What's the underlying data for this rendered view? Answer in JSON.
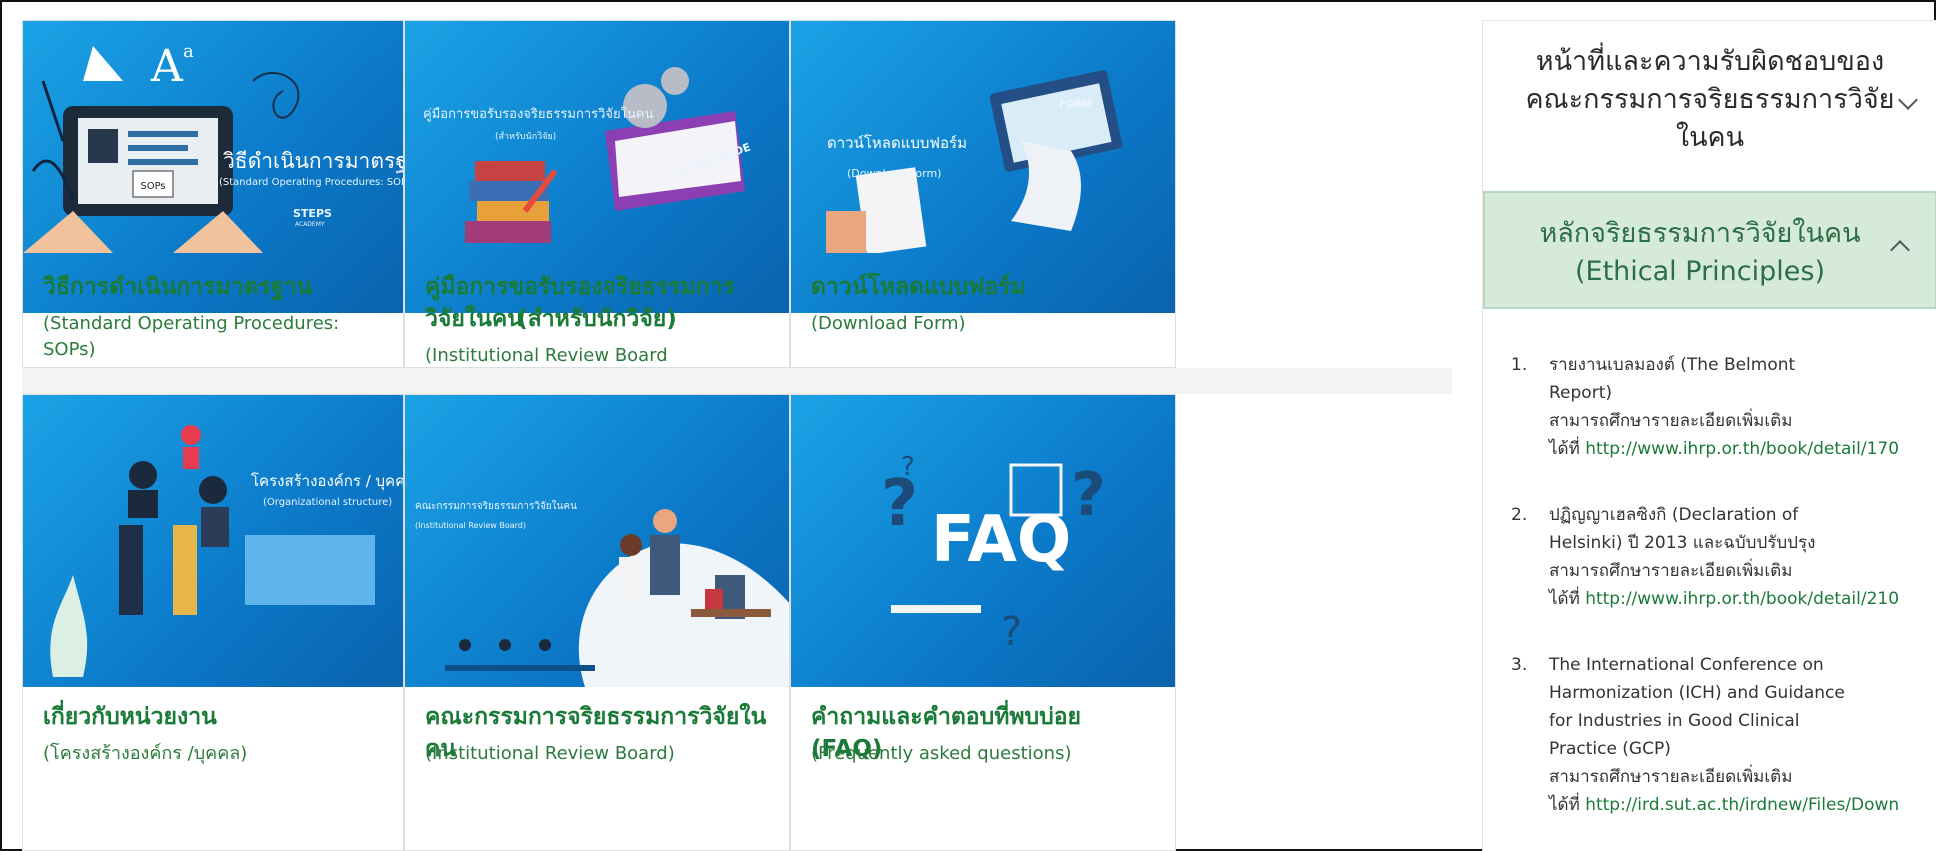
{
  "cards": [
    {
      "banner_title": "วิธีดำเนินการมาตรฐาน",
      "banner_sub": "(Standard Operating Procedures: SOPs)",
      "banner_badge": "SOPs",
      "banner_logo": "STEPS",
      "banner_logo_sub": "ACADEMY",
      "title": "วิธีการดำเนินการมาตรฐาน",
      "subtitle": "(Standard Operating Procedures: SOPs)"
    },
    {
      "banner_title": "คู่มือการขอรับรองจริยธรรมการวิจัยในคน",
      "banner_sub": "(สำหรับนักวิจัย)",
      "banner_badge": "USER GUIDE",
      "title_line1": "คู่มือการขอรับรองจริยธรรมการวิจัยในคน",
      "title_line2": "(สำหรับนักวิจัย)",
      "subtitle": "(Institutional Review Board Guildbook)"
    },
    {
      "banner_title": "ดาวน์โหลดแบบฟอร์ม",
      "banner_sub": "(Download Form)",
      "banner_badge": "FORM",
      "title": "ดาวน์โหลดแบบฟอร์ม",
      "subtitle": "(Download Form)"
    },
    {
      "banner_title": "โครงสร้างองค์กร / บุคคล",
      "banner_sub": "(Organizational structure)",
      "title": "เกี่ยวกับหน่วยงาน",
      "subtitle": "(โครงสร้างองค์กร /บุคคล)"
    },
    {
      "banner_title": "คณะกรรมการจริยธรรมการวิจัยในคน",
      "banner_sub": "(Institutional Review Board)",
      "title": "คณะกรรมการจริยธรรมการวิจัยในคน",
      "subtitle": "(Institutional Review Board)"
    },
    {
      "banner_title": "FAQ",
      "title": "คำถามและคำตอบที่พบบ่อย (FAQ)",
      "subtitle": "(Frequently asked questions)"
    }
  ],
  "sidebar": {
    "accordion1": {
      "title_line1": "หน้าที่และความรับผิดชอบของ",
      "title_line2": "คณะกรรมการจริยธรรมการวิจัย",
      "title_line3": "ในคน"
    },
    "accordion2": {
      "title_line1": "หลักจริยธรรมการวิจัยในคน",
      "title_line2": "(Ethical Principles)"
    },
    "items": [
      {
        "num": "1.",
        "line1": "รายงานเบลมองต์ (The Belmont",
        "line2": "Report)",
        "line3": "สามารถศึกษารายละเอียดเพิ่มเติม",
        "prefix": "ได้ที่ ",
        "link": "http://www.ihrp.or.th/book/detail/170"
      },
      {
        "num": "2.",
        "line1": "ปฏิญญาเฮลซิงกิ (Declaration of",
        "line2": "Helsinki) ปี 2013 และฉบับปรับปรุง",
        "line3": "สามารถศึกษารายละเอียดเพิ่มเติม",
        "prefix": "ได้ที่ ",
        "link": "http://www.ihrp.or.th/book/detail/210"
      },
      {
        "num": "3.",
        "line1": "The International Conference on",
        "line2": "Harmonization (ICH) and Guidance",
        "line3": "for Industries in Good Clinical",
        "line4": "Practice (GCP)",
        "line5": "สามารถศึกษารายละเอียดเพิ่มเติม",
        "prefix": "ได้ที่ ",
        "link": "http://ird.sut.ac.th/irdnew/Files/Down"
      }
    ]
  },
  "colors": {
    "title_green": "#1a7a38",
    "banner_blue": "#1ba3e6",
    "accordion_active_bg": "#d6eadc"
  }
}
